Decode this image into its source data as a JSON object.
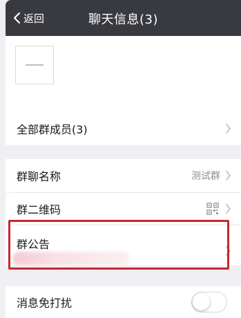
{
  "header": {
    "back_label": "返回",
    "title": "聊天信息(3)"
  },
  "members": {
    "all_members_label": "全部群成员(3)"
  },
  "settings": {
    "group_name_label": "群聊名称",
    "group_name_value": "测试群",
    "qr_code_label": "群二维码",
    "announcement_label": "群公告",
    "mute_label": "消息免打扰",
    "mute_enabled": false
  },
  "colors": {
    "navbar": "#393a3f",
    "highlight": "#c7262d",
    "background": "#efeff4"
  },
  "icons": [
    "chevron-left-icon",
    "chevron-right-icon",
    "qr-code-icon"
  ]
}
